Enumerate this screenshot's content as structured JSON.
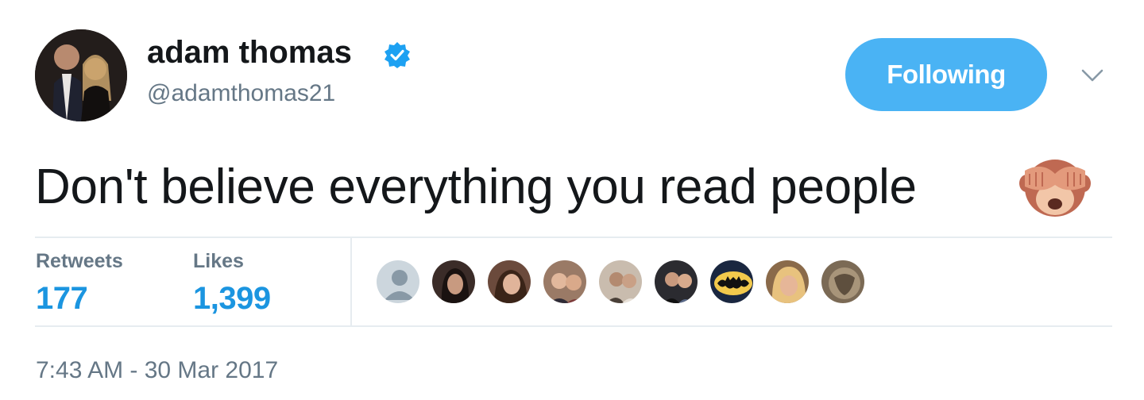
{
  "user": {
    "display_name": "adam thomas",
    "handle": "@adamthomas21",
    "verified": true,
    "avatar_icon": "profile-photo-couple"
  },
  "follow_button": {
    "label": "Following",
    "color": "#4ab3f4"
  },
  "menu_caret_icon": "chevron-down-icon",
  "tweet": {
    "text": "Don't believe everything you read people",
    "emoji": "see-no-evil-monkey"
  },
  "stats": {
    "retweets": {
      "label": "Retweets",
      "value": "177"
    },
    "likes": {
      "label": "Likes",
      "value": "1,399"
    }
  },
  "likers": [
    {
      "icon": "default-avatar",
      "color": "#ccd6dd"
    },
    {
      "icon": "profile-photo",
      "color": "#3b2c28"
    },
    {
      "icon": "profile-photo",
      "color": "#6b4a3c"
    },
    {
      "icon": "profile-photo",
      "color": "#9a7a66"
    },
    {
      "icon": "profile-photo",
      "color": "#c9bcae"
    },
    {
      "icon": "profile-photo",
      "color": "#2b2b30"
    },
    {
      "icon": "batman-birthday-logo",
      "color": "#1a2740"
    },
    {
      "icon": "profile-photo",
      "color": "#c9a36b"
    },
    {
      "icon": "profile-photo",
      "color": "#7b6a55"
    }
  ],
  "timestamp": "7:43 AM - 30 Mar 2017",
  "colors": {
    "link_blue": "#1b95e0",
    "secondary_text": "#657786",
    "divider": "#e6ecf0"
  }
}
